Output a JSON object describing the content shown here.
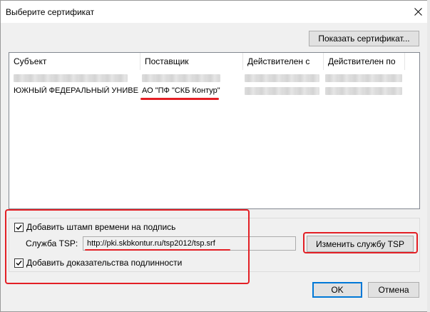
{
  "window": {
    "title": "Выберите сертификат",
    "close_icon": "close-icon"
  },
  "toolbar": {
    "show_certificate_label": "Показать сертификат..."
  },
  "table": {
    "columns": [
      "Субъект",
      "Поставщик",
      "Действителен с",
      "Действителен по"
    ],
    "rows": [
      {
        "subject": "ЮЖНЫЙ ФЕДЕРАЛЬНЫЙ УНИВЕ...",
        "issuer": "АО \"ПФ \"СКБ Контур\"",
        "valid_from": "",
        "valid_to": ""
      }
    ]
  },
  "options": {
    "timestamp_label": "Добавить штамп времени на подпись",
    "timestamp_checked": true,
    "tsp_label": "Служба TSP:",
    "tsp_value": "http://pki.skbkontur.ru/tsp2012/tsp.srf",
    "evidence_label": "Добавить доказательства подлинности",
    "evidence_checked": true,
    "change_tsp_label": "Изменить службу TSP"
  },
  "footer": {
    "ok_label": "OK",
    "cancel_label": "Отмена"
  },
  "colors": {
    "highlight": "#e31f25",
    "accent": "#0078d7",
    "dialog_bg": "#f0f0f0"
  }
}
